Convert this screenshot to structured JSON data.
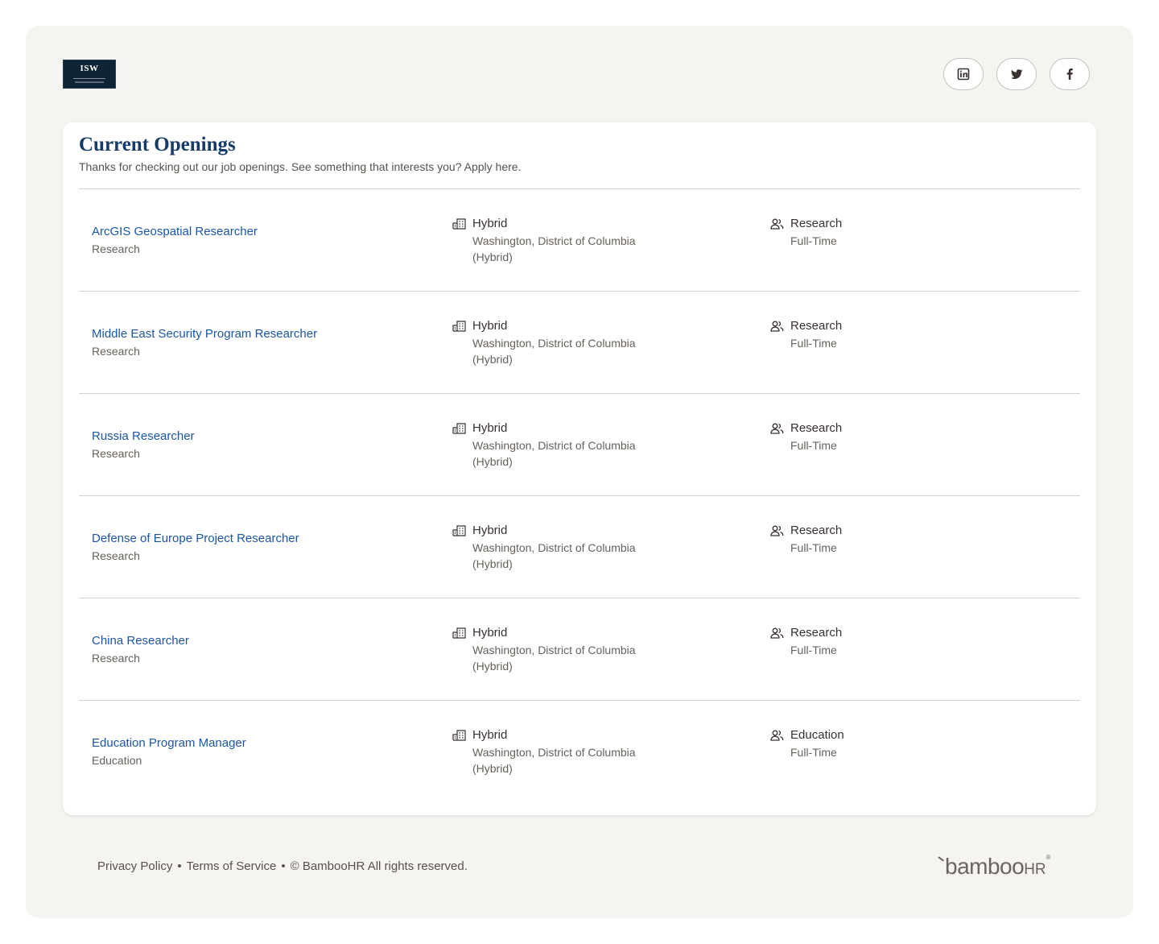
{
  "header": {
    "logo_text": "ISW",
    "social": [
      "linkedin-icon",
      "twitter-icon",
      "facebook-icon"
    ]
  },
  "openings": {
    "title": "Current Openings",
    "subtitle": "Thanks for checking out our job openings. See something that interests you? Apply here.",
    "jobs": [
      {
        "title": "ArcGIS Geospatial Researcher",
        "department": "Research",
        "location_type": "Hybrid",
        "location": "Washington, District of Columbia",
        "location_note": "(Hybrid)",
        "team": "Research",
        "employment": "Full-Time"
      },
      {
        "title": "Middle East Security Program Researcher",
        "department": "Research",
        "location_type": "Hybrid",
        "location": "Washington, District of Columbia",
        "location_note": "(Hybrid)",
        "team": "Research",
        "employment": "Full-Time"
      },
      {
        "title": "Russia Researcher",
        "department": "Research",
        "location_type": "Hybrid",
        "location": "Washington, District of Columbia",
        "location_note": "(Hybrid)",
        "team": "Research",
        "employment": "Full-Time"
      },
      {
        "title": "Defense of Europe Project Researcher",
        "department": "Research",
        "location_type": "Hybrid",
        "location": "Washington, District of Columbia",
        "location_note": "(Hybrid)",
        "team": "Research",
        "employment": "Full-Time"
      },
      {
        "title": "China Researcher",
        "department": "Research",
        "location_type": "Hybrid",
        "location": "Washington, District of Columbia",
        "location_note": "(Hybrid)",
        "team": "Research",
        "employment": "Full-Time"
      },
      {
        "title": "Education Program Manager",
        "department": "Education",
        "location_type": "Hybrid",
        "location": "Washington, District of Columbia",
        "location_note": "(Hybrid)",
        "team": "Education",
        "employment": "Full-Time"
      }
    ]
  },
  "footer": {
    "privacy": "Privacy Policy",
    "separator": "•",
    "terms": "Terms of Service",
    "copyright": "© BambooHR All rights reserved.",
    "brand_main": "bamboo",
    "brand_hr": "HR",
    "brand_reg": "®"
  },
  "colors": {
    "accent": "#1b56a5",
    "heading": "#163b68",
    "page_bg": "#f5f4f1"
  }
}
